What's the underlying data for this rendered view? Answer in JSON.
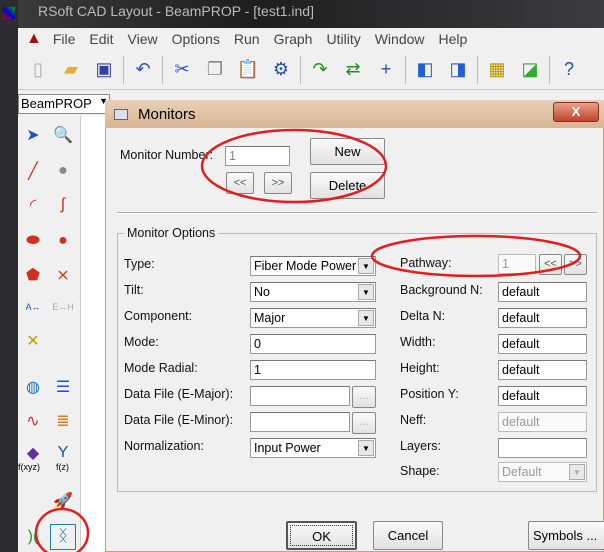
{
  "app": {
    "title": "RSoft CAD Layout - BeamPROP - [test1.ind]",
    "menu": [
      "File",
      "Edit",
      "View",
      "Options",
      "Run",
      "Graph",
      "Utility",
      "Window",
      "Help"
    ],
    "program_combo": "BeamPROP",
    "palette_labels": [
      "f(xyz)",
      "f(z)"
    ]
  },
  "dialog": {
    "title": "Monitors",
    "close": "X",
    "monitor_number_label": "Monitor Number:",
    "monitor_number": "1",
    "new": "New",
    "delete": "Delete",
    "prev": "<<",
    "next": ">>",
    "group_title": "Monitor Options",
    "left": [
      {
        "label": "Type:",
        "value": "Fiber Mode Power",
        "kind": "select"
      },
      {
        "label": "Tilt:",
        "value": "No",
        "kind": "select"
      },
      {
        "label": "Component:",
        "value": "Major",
        "kind": "select"
      },
      {
        "label": "Mode:",
        "value": "0",
        "kind": "text"
      },
      {
        "label": "Mode Radial:",
        "value": "1",
        "kind": "text"
      },
      {
        "label": "Data File (E-Major):",
        "value": "",
        "kind": "file"
      },
      {
        "label": "Data File (E-Minor):",
        "value": "",
        "kind": "file"
      },
      {
        "label": "Normalization:",
        "value": "Input Power",
        "kind": "select"
      }
    ],
    "browse": "...",
    "pathway_label": "Pathway:",
    "pathway": "1",
    "right": [
      {
        "label": "Background N:",
        "value": "default"
      },
      {
        "label": "Delta N:",
        "value": "default"
      },
      {
        "label": "Width:",
        "value": "default"
      },
      {
        "label": "Height:",
        "value": "default"
      },
      {
        "label": "Position Y:",
        "value": "default"
      },
      {
        "label": "Neff:",
        "value": "default",
        "disabled": true
      },
      {
        "label": "Layers:",
        "value": ""
      }
    ],
    "shape_label": "Shape:",
    "shape": "Default",
    "ok": "OK",
    "cancel": "Cancel",
    "symbols": "Symbols ..."
  },
  "annotation_color": "#e02020"
}
